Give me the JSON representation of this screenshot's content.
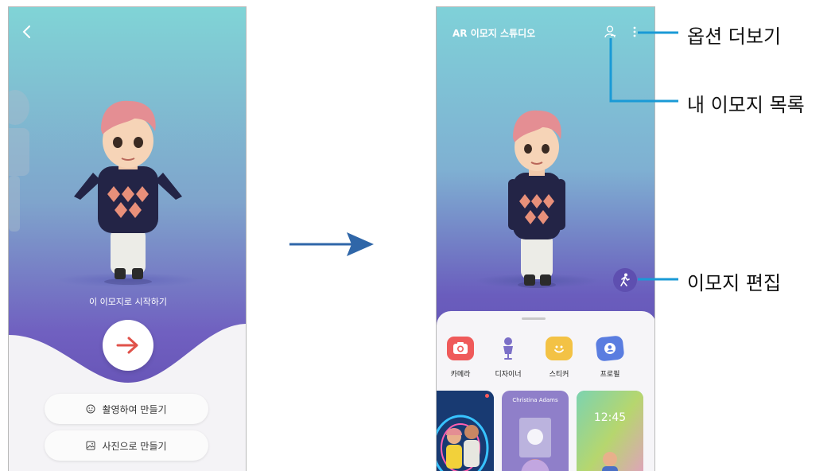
{
  "left_screen": {
    "start_label": "이 이모지로 시작하기",
    "buttons": [
      {
        "label": "촬영하여 만들기",
        "icon": "smile-face-icon"
      },
      {
        "label": "사진으로 만들기",
        "icon": "image-icon"
      }
    ]
  },
  "right_screen": {
    "title": "AR 이모지 스튜디오",
    "categories": [
      {
        "label": "카메라",
        "icon": "camera-icon",
        "color": "#ef5a5a"
      },
      {
        "label": "디자이너",
        "icon": "mannequin-icon",
        "color": "#7b6fc7"
      },
      {
        "label": "스티커",
        "icon": "sticker-icon",
        "color": "#f3c245"
      },
      {
        "label": "프로필",
        "icon": "profile-card-icon",
        "color": "#5a7de0"
      }
    ],
    "cards": [
      {
        "caption": ""
      },
      {
        "caption": "Christina Adams"
      },
      {
        "caption": "12:45"
      }
    ]
  },
  "annotations": {
    "more_options": "옵션 더보기",
    "my_emoji_list": "내 이모지 목록",
    "edit_emoji": "이모지 편집"
  },
  "colors": {
    "annotation_line": "#1a9ad6",
    "accent_red": "#e0524a",
    "sky_top": "#7fd3d6",
    "sky_bottom": "#6a52b6"
  }
}
